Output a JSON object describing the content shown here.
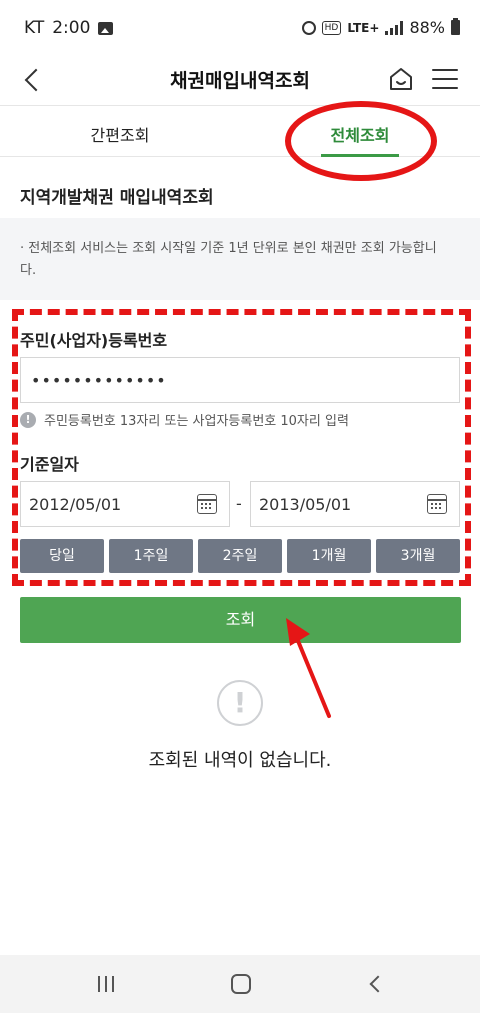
{
  "status_bar": {
    "carrier": "KT",
    "time": "2:00",
    "network": "LTE+",
    "battery": "88%"
  },
  "header": {
    "title": "채권매입내역조회",
    "icons": {
      "back": "chevron-left-icon",
      "home": "home-icon",
      "menu": "hamburger-menu-icon"
    }
  },
  "tabs": [
    {
      "label": "간편조회",
      "active": false
    },
    {
      "label": "전체조회",
      "active": true
    }
  ],
  "section": {
    "title": "지역개발채권 매입내역조회"
  },
  "notice": {
    "text": "· 전체조회 서비스는 조회 시작일 기준 1년 단위로 본인 채권만 조회 가능합니다."
  },
  "form": {
    "id_label": "주민(사업자)등록번호",
    "id_value": "•••••••••••••",
    "hint": "주민등록번호 13자리 또는 사업자등록번호 10자리 입력",
    "date_label": "기준일자",
    "start_date": "2012/05/01",
    "date_separator": "-",
    "end_date": "2013/05/01",
    "quick_ranges": [
      "당일",
      "1주일",
      "2주일",
      "1개월",
      "3개월"
    ],
    "search_label": "조회"
  },
  "empty_state": {
    "icon": "!",
    "text": "조회된 내역이 없습니다."
  },
  "colors": {
    "accent_green": "#4fa553",
    "quick_button": "#6f7785",
    "annotation_red": "#e51616"
  }
}
